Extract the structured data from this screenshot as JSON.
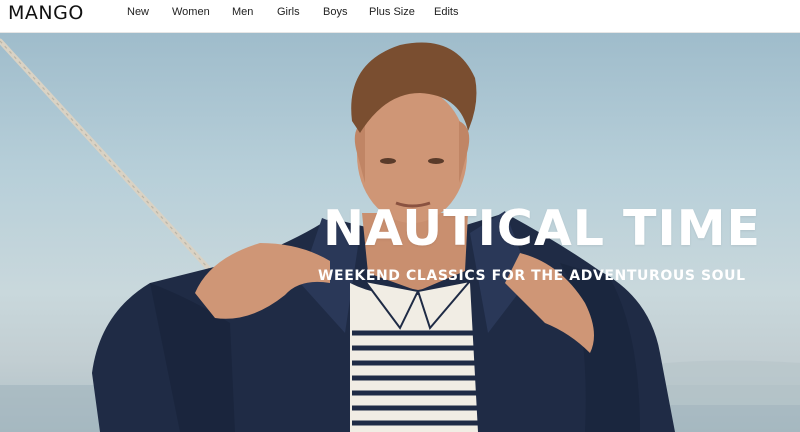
{
  "brand": {
    "logo_text": "MANGO"
  },
  "nav": {
    "items": [
      {
        "label": "New"
      },
      {
        "label": "Women"
      },
      {
        "label": "Men"
      },
      {
        "label": "Girls"
      },
      {
        "label": "Boys"
      },
      {
        "label": "Plus Size"
      },
      {
        "label": "Edits"
      }
    ]
  },
  "hero": {
    "title": "NAUTICAL TIME",
    "subtitle": "WEEKEND CLASSICS FOR THE ADVENTUROUS SOUL",
    "image_subject": "man-in-navy-jacket-striped-polo"
  },
  "colors": {
    "nav_text": "#222222",
    "hero_text": "#ffffff",
    "sky": "#b7cfd9",
    "jacket": "#1f2b45"
  }
}
